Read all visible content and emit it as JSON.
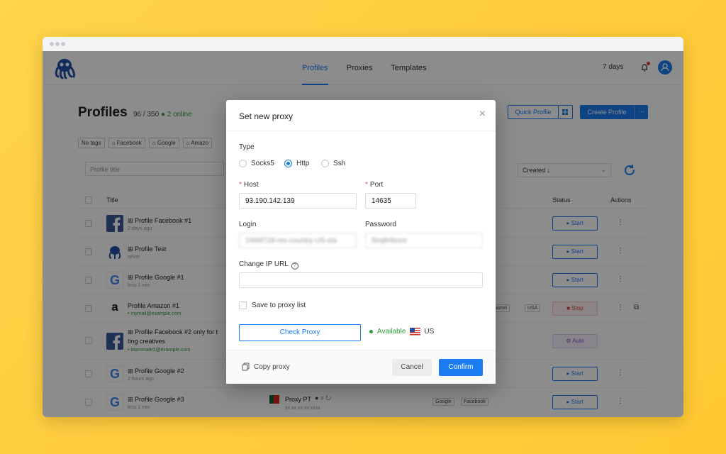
{
  "nav": {
    "tabs": [
      "Profiles",
      "Proxies",
      "Templates"
    ],
    "active_tab": "Profiles",
    "trial": "7 days"
  },
  "header": {
    "title": "Profiles",
    "counts": "96 / 350",
    "online": "2 online",
    "quick_profile": "Quick Profile",
    "create_profile": "Create Profile"
  },
  "tags": [
    "No tags",
    "Facebook",
    "Google",
    "Amazo"
  ],
  "filters": {
    "title_placeholder": "Profile title",
    "sort_label": "Created ↓"
  },
  "table": {
    "columns": {
      "title": "Title",
      "status": "Status",
      "actions": "Actions"
    },
    "rows": [
      {
        "name": "Profile Facebook #1",
        "sub": "2 days ago",
        "status": "Start"
      },
      {
        "name": "Profile Test",
        "sub": "never",
        "status": "Start"
      },
      {
        "name": "Profile Google #1",
        "sub": "less 1 min",
        "status": "Start"
      },
      {
        "name": "Profile Amazon #1",
        "sub": "mymail@example.com",
        "status": "Stop",
        "tags": [
          "mazon",
          "USA"
        ]
      },
      {
        "name": "Profile Facebook #2 only for t",
        "name2": "ting creatives",
        "sub": "teammate1@example.com",
        "status": "Auto"
      },
      {
        "name": "Profile Google #2",
        "sub": "2 hours ago",
        "status": "Start"
      },
      {
        "name": "Profile Google #3",
        "sub": "less 1 min",
        "status": "Start",
        "proxy": "Proxy PT",
        "proxy_ip": "xx.xx.xx.xx:xxxx",
        "tags": [
          "Google",
          "Facebook"
        ]
      }
    ]
  },
  "modal": {
    "title": "Set new proxy",
    "type_label": "Type",
    "types": [
      "Socks5",
      "Http",
      "Ssh"
    ],
    "selected_type": "Http",
    "host_label": "Host",
    "host": "93.190.142.139",
    "port_label": "Port",
    "port": "14635",
    "login_label": "Login",
    "login": "2466f728-res-country-US-sta",
    "password_label": "Password",
    "password": "5lrq8r8esm",
    "change_ip_label": "Change IP URL",
    "change_ip_value": "",
    "save_label": "Save to proxy list",
    "check_proxy": "Check Proxy",
    "available": "Available",
    "country": "US",
    "copy_proxy": "Copy proxy",
    "cancel": "Cancel",
    "confirm": "Confirm"
  },
  "colors": {
    "accent": "#1a7cf0",
    "online": "#2e9b3a",
    "backdrop": "#ffcc3d"
  }
}
